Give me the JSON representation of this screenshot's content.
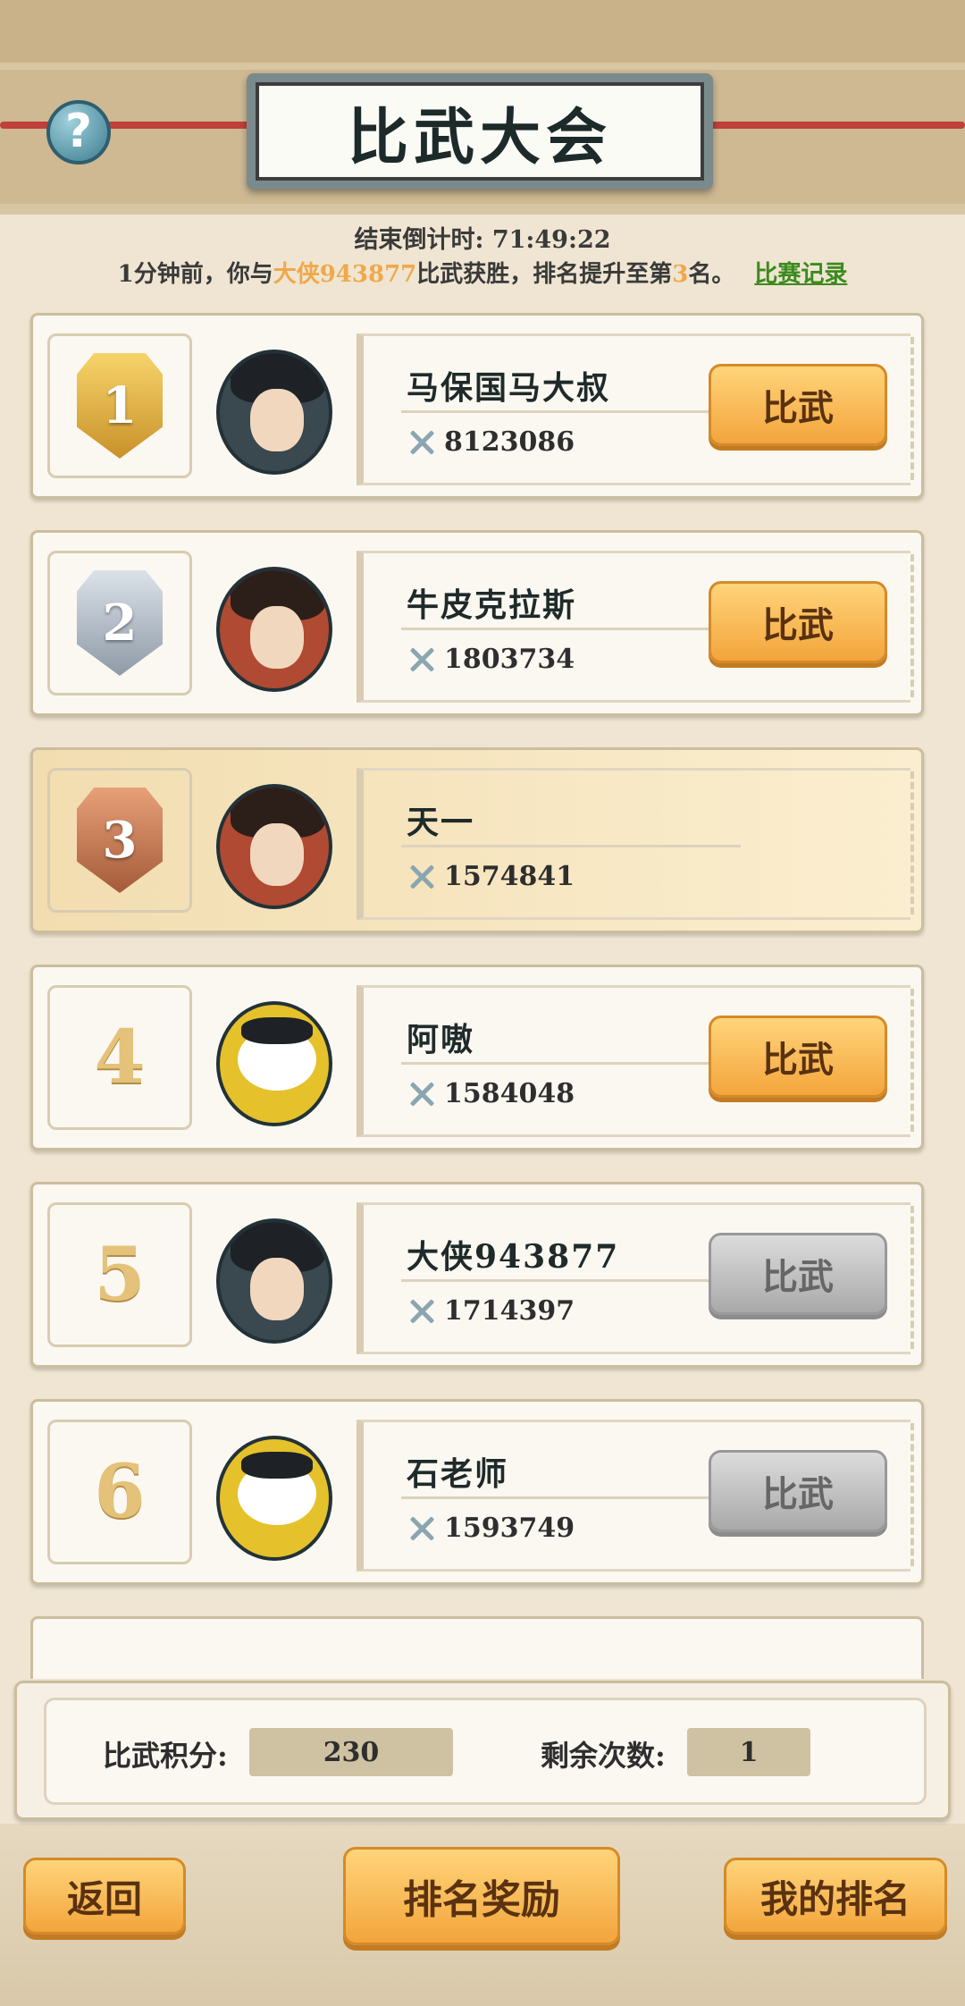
{
  "header": {
    "title": "比武大会",
    "help_icon": "?"
  },
  "countdown": {
    "label": "结束倒计时:",
    "value": "71:49:22"
  },
  "notice": {
    "prefix": "1分钟前，你与",
    "opponent": "大侠943877",
    "middle": "比武获胜，排名提升至第",
    "rank": "3",
    "suffix": "名。",
    "record_link": "比赛记录"
  },
  "players": [
    {
      "rank": "1",
      "name": "马保国马大叔",
      "power": "8123086",
      "button": "比武",
      "button_state": "active",
      "avatar": "swordsman-avatar",
      "medal": "gold"
    },
    {
      "rank": "2",
      "name": "牛皮克拉斯",
      "power": "1803734",
      "button": "比武",
      "button_state": "active",
      "avatar": "warrior-avatar",
      "medal": "silver"
    },
    {
      "rank": "3",
      "name": "天一",
      "power": "1574841",
      "button": "",
      "button_state": "self",
      "avatar": "warrior-avatar",
      "medal": "bronze"
    },
    {
      "rank": "4",
      "name": "阿嗷",
      "power": "1584048",
      "button": "比武",
      "button_state": "active",
      "avatar": "panda-avatar"
    },
    {
      "rank": "5",
      "name": "大侠943877",
      "power": "1714397",
      "button": "比武",
      "button_state": "disabled",
      "avatar": "swordsman-avatar"
    },
    {
      "rank": "6",
      "name": "石老师",
      "power": "1593749",
      "button": "比武",
      "button_state": "disabled",
      "avatar": "panda-avatar"
    }
  ],
  "stats": {
    "score_label": "比武积分:",
    "score_value": "230",
    "remaining_label": "剩余次数:",
    "remaining_value": "1"
  },
  "buttons": {
    "back": "返回",
    "rewards": "排名奖励",
    "my_rank": "我的排名"
  }
}
